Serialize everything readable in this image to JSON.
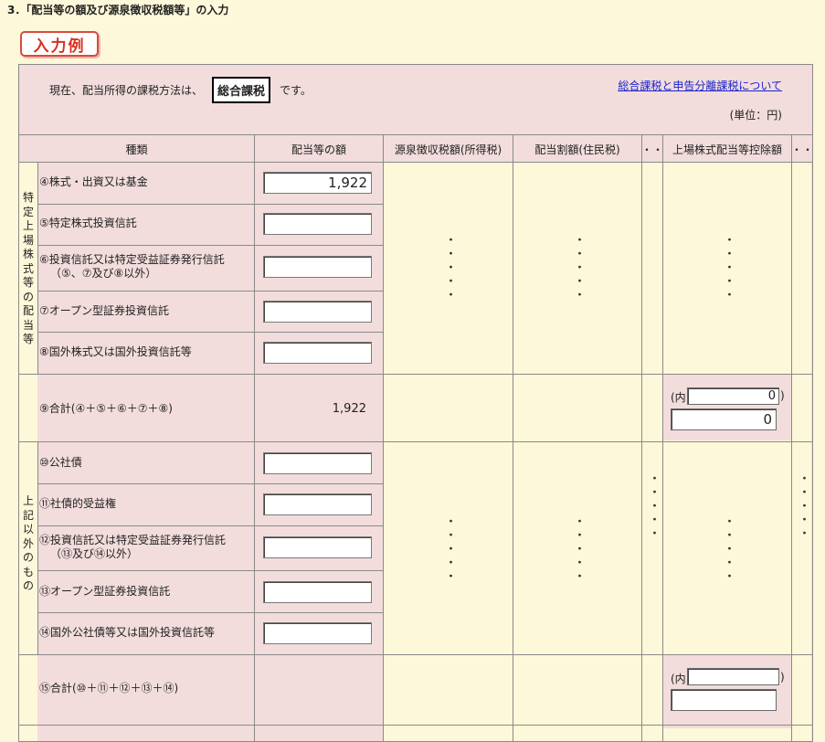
{
  "section_title": "3．「配当等の額及び源泉徴収税額等」の入力",
  "example_badge": "入力例",
  "info": {
    "prefix": "現在、配当所得の課税方法は、",
    "method": "総合課税",
    "suffix": "です。",
    "link": "総合課税と申告分離課税について",
    "unit": "(単位：円)"
  },
  "headers": {
    "kind": "種類",
    "amount": "配当等の額",
    "withholding": "源泉徴収税額(所得税)",
    "resident": "配当割額(住民税)",
    "more1": "・・",
    "listed_deduction": "上場株式配当等控除額",
    "more2": "・・"
  },
  "groups": [
    {
      "label_chars": [
        "特",
        "定",
        "上",
        "場",
        "株",
        "式",
        "等",
        "の",
        "配",
        "当",
        "等"
      ],
      "rows": [
        {
          "label": "④株式・出資又は基金",
          "value": "1,922"
        },
        {
          "label": "⑤特定株式投資信託",
          "value": ""
        },
        {
          "label": "⑥投資信託又は特定受益証券発行信託",
          "label2": "（⑤、⑦及び⑧以外）",
          "value": ""
        },
        {
          "label": "⑦オープン型証券投資信託",
          "value": ""
        },
        {
          "label": "⑧国外株式又は国外投資信託等",
          "value": ""
        }
      ],
      "total": {
        "label": "⑨合計(④＋⑤＋⑥＋⑦＋⑧)",
        "value": "1,922",
        "inner_prefix": "(内",
        "inner_suffix": ")",
        "inner_value": "0",
        "deduction_value": "0"
      }
    },
    {
      "label_chars": [
        "上",
        "記",
        "以",
        "外",
        "の",
        "も",
        "の"
      ],
      "rows": [
        {
          "label": "⑩公社債",
          "value": ""
        },
        {
          "label": "⑪社債的受益権",
          "value": ""
        },
        {
          "label": "⑫投資信託又は特定受益証券発行信託",
          "label2": "（⑬及び⑭以外）",
          "value": ""
        },
        {
          "label": "⑬オープン型証券投資信託",
          "value": ""
        },
        {
          "label": "⑭国外公社債等又は国外投資信託等",
          "value": ""
        }
      ],
      "total": {
        "label": "⑮合計(⑩＋⑪＋⑫＋⑬＋⑭)",
        "value": "",
        "inner_prefix": "(内",
        "inner_suffix": ")",
        "inner_value": "",
        "deduction_value": ""
      }
    }
  ],
  "ellipsis": "・"
}
